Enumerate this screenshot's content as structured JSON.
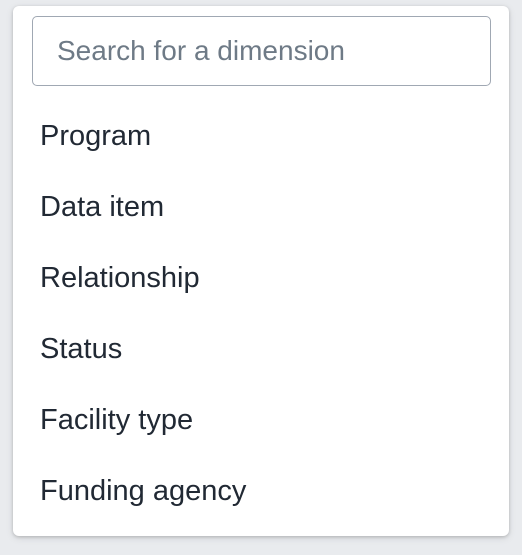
{
  "search": {
    "placeholder": "Search for a dimension",
    "value": ""
  },
  "dimensions": [
    {
      "label": "Program"
    },
    {
      "label": "Data item"
    },
    {
      "label": "Relationship"
    },
    {
      "label": "Status"
    },
    {
      "label": "Facility type"
    },
    {
      "label": "Funding agency"
    }
  ],
  "colors": {
    "page_background": "#e9ebee",
    "popover_background": "#ffffff",
    "input_border": "#a0a8b3",
    "placeholder_text": "#6e7a86",
    "item_text": "#212934"
  }
}
